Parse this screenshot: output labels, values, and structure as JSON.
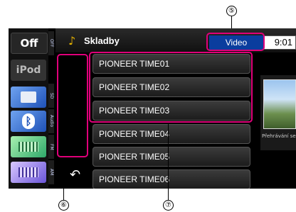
{
  "sources": [
    {
      "label": "Off",
      "tab": "OFF",
      "color": "#2a2a2a"
    },
    {
      "label": "iPod",
      "tab": "",
      "color": "#3a3a3a"
    },
    {
      "label": "",
      "tab": "SD",
      "color": "#2d6bd1",
      "icon": "sd-card-icon"
    },
    {
      "label": "",
      "tab": "Audio",
      "color": "#2d6bd1",
      "icon": "bluetooth-icon"
    },
    {
      "label": "",
      "tab": "FM",
      "color": "#38a66a",
      "icon": "fm-radio-icon"
    },
    {
      "label": "",
      "tab": "AM",
      "color": "#8a7ae0",
      "icon": "am-radio-icon"
    }
  ],
  "header": {
    "title": "Skladby",
    "video_label": "Video",
    "clock": "9:01"
  },
  "tracks": [
    "PIONEER TIME01",
    "PIONEER TIME02",
    "PIONEER TIME03",
    "PIONEER TIME04",
    "PIONEER TIME05",
    "PIONEER TIME06"
  ],
  "art": {
    "caption": "Přehrávání se"
  },
  "callouts": {
    "c5": "⑤",
    "c6": "⑥",
    "c7": "⑦"
  },
  "colors": {
    "accent_box": "#e0007a",
    "video_blue": "#0a3d9e",
    "note_gold": "#e8b400"
  }
}
